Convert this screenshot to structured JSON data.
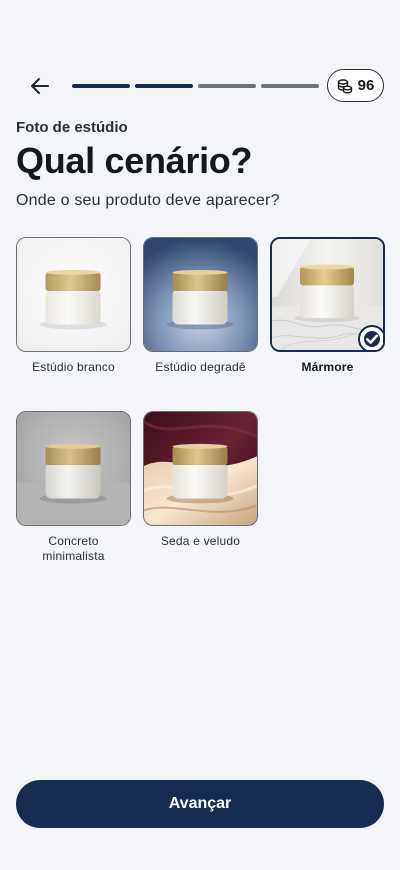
{
  "header": {
    "back_icon": "arrow-left-icon",
    "progress_total": 4,
    "progress_completed": 2,
    "credits": "96",
    "credits_icon": "coins-icon"
  },
  "eyebrow": "Foto de estúdio",
  "title": "Qual cenário?",
  "subtitle": "Onde o seu produto deve aparecer?",
  "options": [
    {
      "label": "Estúdio branco"
    },
    {
      "label": "Estúdio degradê"
    },
    {
      "label": "Mármore",
      "selected": true
    },
    {
      "label": "Concreto minimalista"
    },
    {
      "label": "Seda e veludo"
    }
  ],
  "cta": "Avançar",
  "colors": {
    "primary": "#172c52",
    "background": "#f3f5f8"
  }
}
